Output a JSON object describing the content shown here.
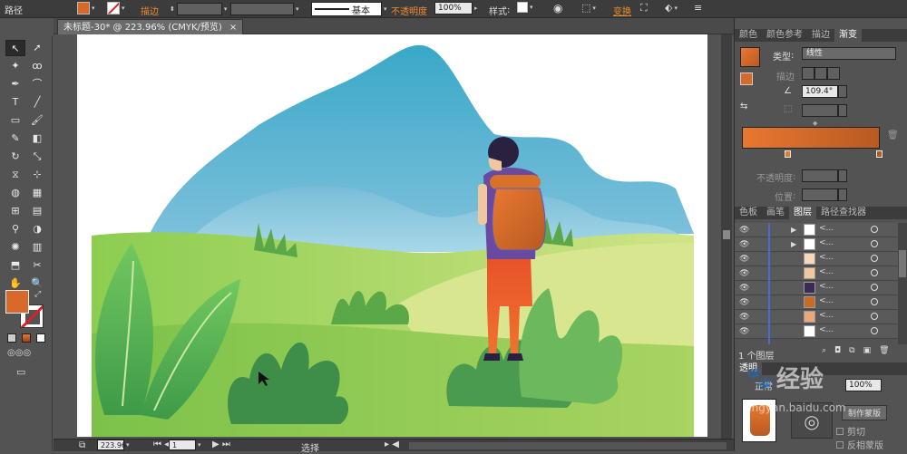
{
  "control_bar": {
    "object_label": "路径",
    "stroke_label": "描边",
    "stroke_line_style": "基本",
    "opacity_label": "不透明度",
    "opacity_value": "100%",
    "style_label": "样式",
    "transform_label": "变换"
  },
  "document_tab": {
    "title": "未标题-30* @ 223.96% (CMYK/预览)",
    "close": "×"
  },
  "status_bar": {
    "zoom": "223.96",
    "page": "1",
    "tool_status": "选择"
  },
  "gradient_panel": {
    "tabs": [
      "颜色",
      "颜色参考",
      "描边",
      "渐变"
    ],
    "active_tab": "渐变",
    "type_label": "类型",
    "type_value": "线性",
    "stroke_label": "描边",
    "angle_value": "109.4°",
    "opacity_label": "不透明度",
    "location_label": "位置",
    "colors": {
      "start": "#e87830",
      "end": "#b85a22"
    }
  },
  "layers_panel": {
    "tabs": [
      "色板",
      "画笔",
      "图层",
      "路径查找器"
    ],
    "active_tab": "图层",
    "layer_count_label": "1 个图层",
    "row_label": "<...",
    "row_thumbs": [
      "#ffffff",
      "#ffffff",
      "#f8d8b8",
      "#f0c8a0",
      "#3a2a55",
      "#c86a28",
      "#e8a878",
      "#ffffff"
    ]
  },
  "transparency_panel": {
    "title": "透明",
    "mode": "正常",
    "opacity": "100%",
    "mask_button": "制作蒙版",
    "clip_label": "剪切",
    "invert_label": "反相蒙版"
  },
  "watermark": {
    "text": "经验",
    "domain": "jingyan.baidu.com"
  },
  "toolbar": {
    "fill_color": "#d8692a",
    "stroke_color": "#ffffff"
  }
}
